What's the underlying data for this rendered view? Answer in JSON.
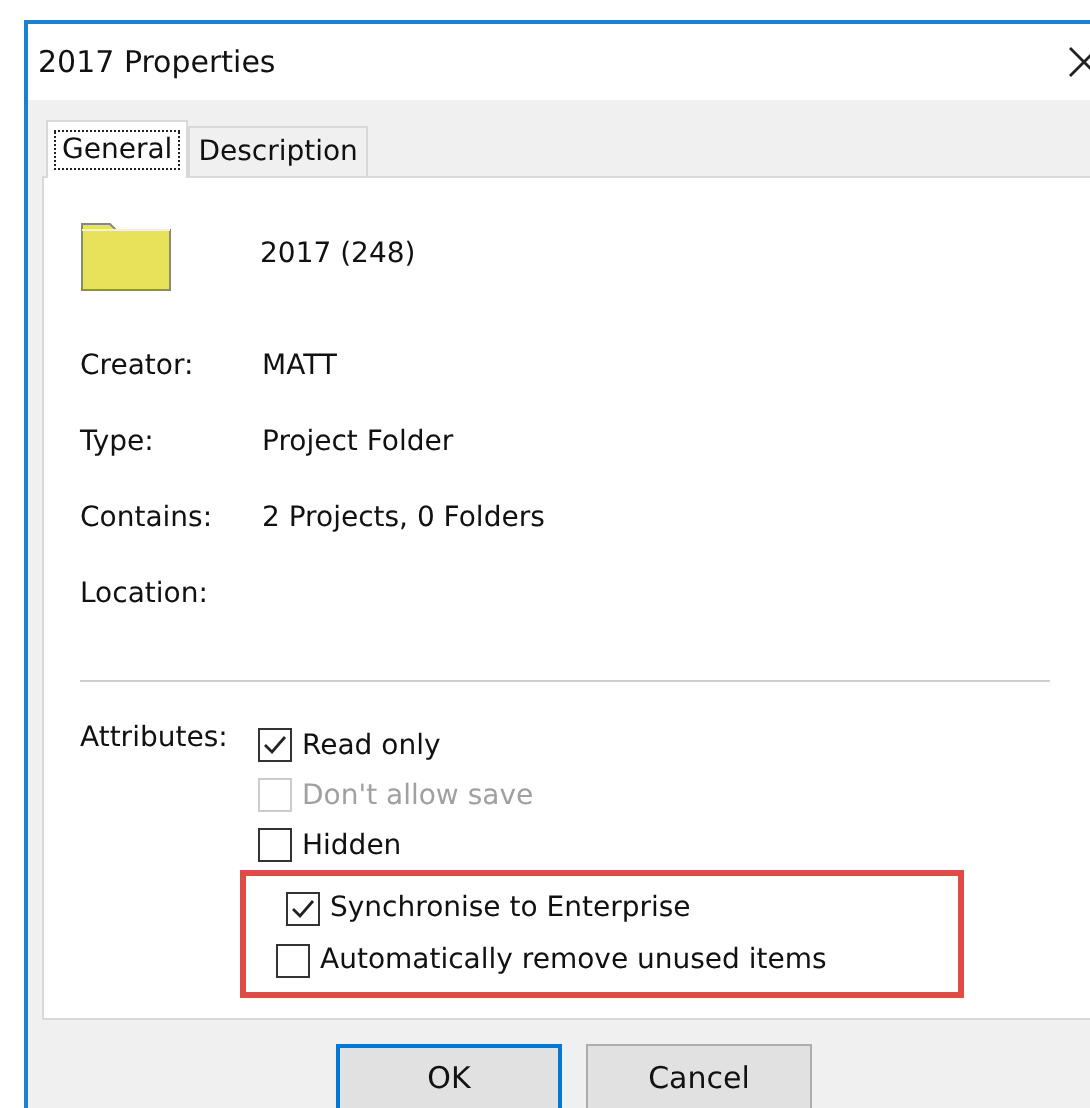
{
  "window": {
    "title": "2017 Properties"
  },
  "tabs": [
    {
      "label": "General",
      "selected": true
    },
    {
      "label": "Description",
      "selected": false
    }
  ],
  "item": {
    "name": "2017 (248)"
  },
  "fields": [
    {
      "label": "Creator:",
      "value": "MATT"
    },
    {
      "label": "Type:",
      "value": "Project Folder"
    },
    {
      "label": "Contains:",
      "value": "2 Projects, 0 Folders"
    },
    {
      "label": "Location:"
    }
  ],
  "attributes": {
    "label": "Attributes:",
    "options": [
      {
        "label": "Read only",
        "checked": true,
        "disabled": false
      },
      {
        "label": "Don't allow save",
        "checked": false,
        "disabled": true
      },
      {
        "label": "Hidden",
        "checked": false,
        "disabled": false
      }
    ]
  },
  "highlighted_options": [
    {
      "label": "Synchronise to Enterprise",
      "checked": true,
      "disabled": false
    },
    {
      "label": "Automatically remove unused items",
      "checked": false,
      "disabled": false
    }
  ],
  "buttons": [
    {
      "label": "OK",
      "default": true
    },
    {
      "label": "Cancel",
      "default": false
    }
  ]
}
